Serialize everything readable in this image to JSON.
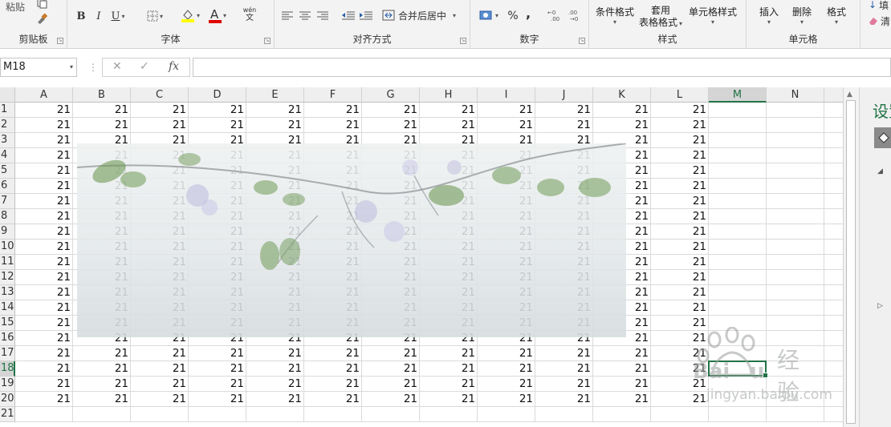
{
  "ribbon": {
    "clipboard": {
      "label": "剪贴板",
      "paste_label": "粘贴"
    },
    "font": {
      "label": "字体",
      "bold": "B",
      "italic": "I",
      "underline": "U",
      "font_color_glyph": "A",
      "phonetic_glyph": "wén"
    },
    "alignment": {
      "label": "对齐方式",
      "merge_center": "合并后居中"
    },
    "number": {
      "label": "数字",
      "percent": "%",
      "comma": ","
    },
    "styles": {
      "label": "样式",
      "conditional_formatting": "条件格式",
      "format_as_table_line1": "套用",
      "format_as_table_line2": "表格格式",
      "cell_styles": "单元格样式"
    },
    "cells": {
      "label": "单元格",
      "insert": "插入",
      "delete": "删除",
      "format": "格式"
    },
    "editing": {
      "fill_label": "填",
      "clear_label": "清"
    }
  },
  "formula_bar": {
    "name_box": "M18",
    "fx_label": "fx",
    "formula": ""
  },
  "grid": {
    "columns": [
      "A",
      "B",
      "C",
      "D",
      "E",
      "F",
      "G",
      "H",
      "I",
      "J",
      "K",
      "L",
      "M",
      "N"
    ],
    "active_column": "M",
    "rows": [
      "1",
      "2",
      "3",
      "4",
      "5",
      "6",
      "7",
      "8",
      "9",
      "10",
      "11",
      "12",
      "13",
      "14",
      "15",
      "16",
      "17",
      "18",
      "19",
      "20",
      "21"
    ],
    "active_row": "18",
    "cell_value": "21",
    "filled_rows": 20,
    "filled_columns": 12,
    "selected_cell": "M18"
  },
  "side_pane": {
    "title": "设置"
  },
  "watermark": {
    "text": "经验",
    "url": "jingyan.baidu.com"
  },
  "colors": {
    "accent": "#217346",
    "ribbon_bg": "#f3f3f3",
    "gridline": "#dadada",
    "header_bg": "#efefef"
  }
}
